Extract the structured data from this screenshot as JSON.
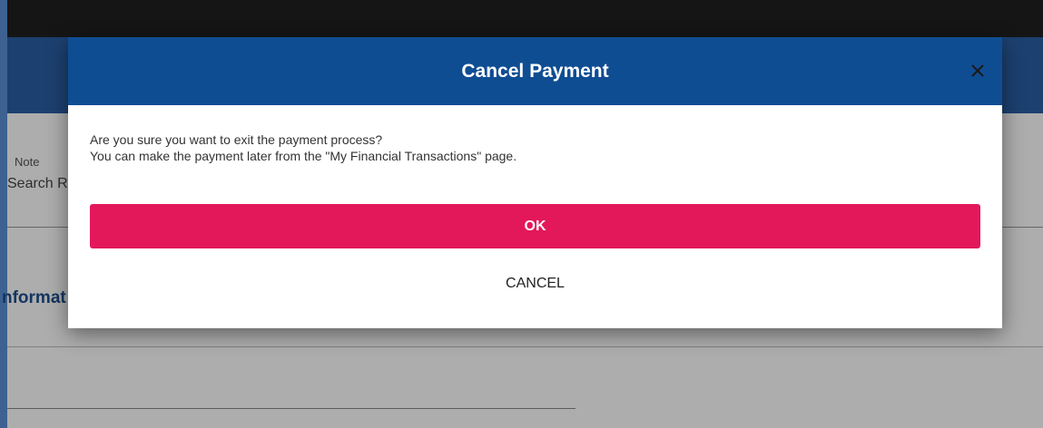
{
  "background_page": {
    "field_label": "Note",
    "field_placeholder": "Search R",
    "section_title": "nformat"
  },
  "modal": {
    "title": "Cancel Payment",
    "close_icon": "close-icon",
    "message_line1": "Are you sure you want to exit the payment process?",
    "message_line2": "You can make the payment later from the \"My Financial Transactions\" page.",
    "ok_label": "OK",
    "cancel_label": "CANCEL"
  },
  "colors": {
    "header_blue": "#0f4d93",
    "ok_button": "#e3185b",
    "topbar": "#1f1f1f"
  }
}
